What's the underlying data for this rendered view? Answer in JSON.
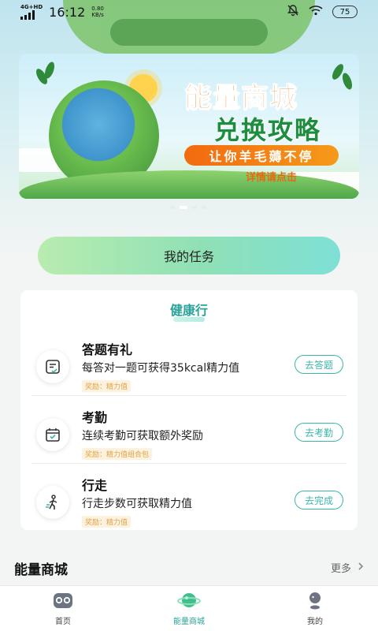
{
  "status": {
    "network": "4G+HD",
    "time": "16:12",
    "speed_value": "0.80",
    "speed_unit": "KB/s",
    "battery": "75"
  },
  "banner": {
    "title_line1": "能量商城",
    "title_line2": "兑换攻略",
    "slogan": "让你羊毛薅不停",
    "detail": "详情请点击"
  },
  "my_tasks_label": "我的任务",
  "task_card": {
    "title": "健康行",
    "tasks": [
      {
        "name": "答题有礼",
        "desc": "每答对一题可获得35kcal精力值",
        "reward": "奖励：精力值",
        "action": "去答题"
      },
      {
        "name": "考勤",
        "desc": "连续考勤可获取额外奖励",
        "reward": "奖励：精力值组合包",
        "action": "去考勤"
      },
      {
        "name": "行走",
        "desc": "行走步数可获取精力值",
        "reward": "奖励：精力值",
        "action": "去完成"
      }
    ]
  },
  "mall": {
    "title": "能量商城",
    "more": "更多"
  },
  "tabbar": [
    {
      "label": "首页",
      "icon": "home-icon"
    },
    {
      "label": "能量商城",
      "icon": "planet-icon"
    },
    {
      "label": "我的",
      "icon": "profile-icon"
    }
  ],
  "colors": {
    "accent": "#2aa39a",
    "reward": "#e0a24a"
  }
}
